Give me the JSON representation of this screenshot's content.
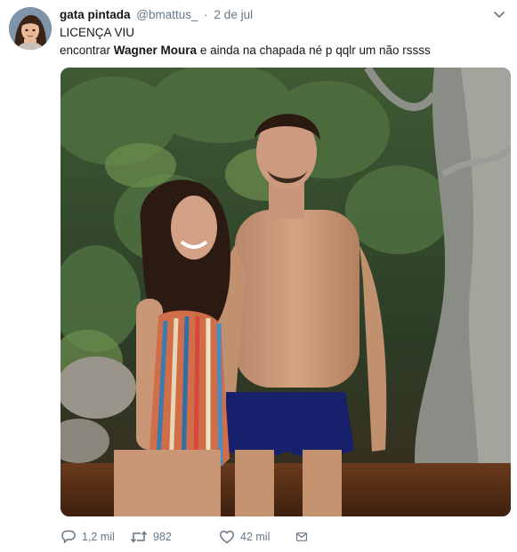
{
  "tweet": {
    "author": {
      "name": "gata pintada",
      "handle": "@bmattus_",
      "separator": "·",
      "date": "2 de jul"
    },
    "text": {
      "line1": "LICENÇA VIU",
      "line2_before": "encontrar ",
      "line2_bold": "Wagner Moura",
      "line2_after": " e ainda na chapada né p qqlr um não rssss"
    },
    "media": {
      "kind": "photo",
      "alt": "photo-couple-by-river"
    },
    "actions": {
      "replies": "1,2 mil",
      "retweets": "982",
      "likes": "42 mil"
    },
    "icons": {
      "reply": "reply-icon",
      "retweet": "retweet-icon",
      "like": "heart-icon",
      "dm": "envelope-icon",
      "caret": "chevron-down-icon"
    },
    "colors": {
      "text": "#14171a",
      "muted": "#657786"
    }
  }
}
